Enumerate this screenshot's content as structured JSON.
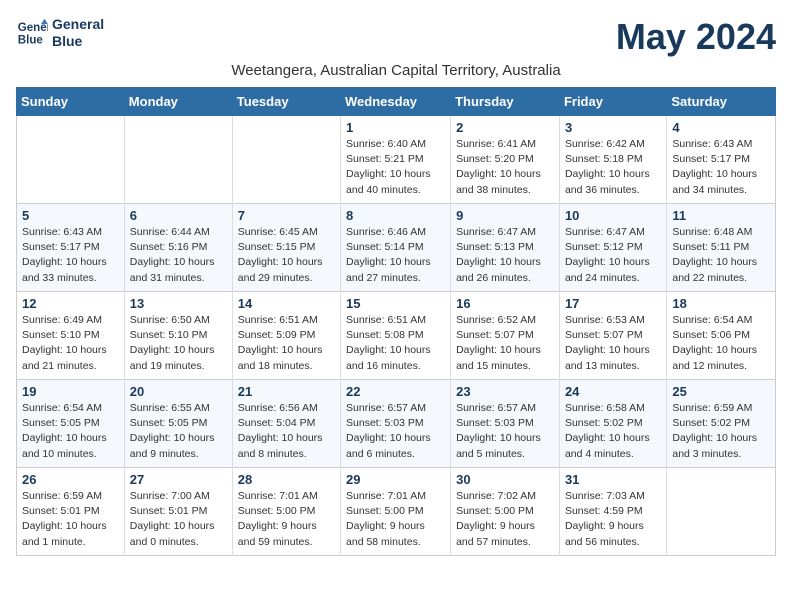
{
  "logo": {
    "text_line1": "General",
    "text_line2": "Blue"
  },
  "title": "May 2024",
  "subtitle": "Weetangera, Australian Capital Territory, Australia",
  "header_days": [
    "Sunday",
    "Monday",
    "Tuesday",
    "Wednesday",
    "Thursday",
    "Friday",
    "Saturday"
  ],
  "weeks": [
    [
      {
        "day": "",
        "info": ""
      },
      {
        "day": "",
        "info": ""
      },
      {
        "day": "",
        "info": ""
      },
      {
        "day": "1",
        "info": "Sunrise: 6:40 AM\nSunset: 5:21 PM\nDaylight: 10 hours\nand 40 minutes."
      },
      {
        "day": "2",
        "info": "Sunrise: 6:41 AM\nSunset: 5:20 PM\nDaylight: 10 hours\nand 38 minutes."
      },
      {
        "day": "3",
        "info": "Sunrise: 6:42 AM\nSunset: 5:18 PM\nDaylight: 10 hours\nand 36 minutes."
      },
      {
        "day": "4",
        "info": "Sunrise: 6:43 AM\nSunset: 5:17 PM\nDaylight: 10 hours\nand 34 minutes."
      }
    ],
    [
      {
        "day": "5",
        "info": "Sunrise: 6:43 AM\nSunset: 5:17 PM\nDaylight: 10 hours\nand 33 minutes."
      },
      {
        "day": "6",
        "info": "Sunrise: 6:44 AM\nSunset: 5:16 PM\nDaylight: 10 hours\nand 31 minutes."
      },
      {
        "day": "7",
        "info": "Sunrise: 6:45 AM\nSunset: 5:15 PM\nDaylight: 10 hours\nand 29 minutes."
      },
      {
        "day": "8",
        "info": "Sunrise: 6:46 AM\nSunset: 5:14 PM\nDaylight: 10 hours\nand 27 minutes."
      },
      {
        "day": "9",
        "info": "Sunrise: 6:47 AM\nSunset: 5:13 PM\nDaylight: 10 hours\nand 26 minutes."
      },
      {
        "day": "10",
        "info": "Sunrise: 6:47 AM\nSunset: 5:12 PM\nDaylight: 10 hours\nand 24 minutes."
      },
      {
        "day": "11",
        "info": "Sunrise: 6:48 AM\nSunset: 5:11 PM\nDaylight: 10 hours\nand 22 minutes."
      }
    ],
    [
      {
        "day": "12",
        "info": "Sunrise: 6:49 AM\nSunset: 5:10 PM\nDaylight: 10 hours\nand 21 minutes."
      },
      {
        "day": "13",
        "info": "Sunrise: 6:50 AM\nSunset: 5:10 PM\nDaylight: 10 hours\nand 19 minutes."
      },
      {
        "day": "14",
        "info": "Sunrise: 6:51 AM\nSunset: 5:09 PM\nDaylight: 10 hours\nand 18 minutes."
      },
      {
        "day": "15",
        "info": "Sunrise: 6:51 AM\nSunset: 5:08 PM\nDaylight: 10 hours\nand 16 minutes."
      },
      {
        "day": "16",
        "info": "Sunrise: 6:52 AM\nSunset: 5:07 PM\nDaylight: 10 hours\nand 15 minutes."
      },
      {
        "day": "17",
        "info": "Sunrise: 6:53 AM\nSunset: 5:07 PM\nDaylight: 10 hours\nand 13 minutes."
      },
      {
        "day": "18",
        "info": "Sunrise: 6:54 AM\nSunset: 5:06 PM\nDaylight: 10 hours\nand 12 minutes."
      }
    ],
    [
      {
        "day": "19",
        "info": "Sunrise: 6:54 AM\nSunset: 5:05 PM\nDaylight: 10 hours\nand 10 minutes."
      },
      {
        "day": "20",
        "info": "Sunrise: 6:55 AM\nSunset: 5:05 PM\nDaylight: 10 hours\nand 9 minutes."
      },
      {
        "day": "21",
        "info": "Sunrise: 6:56 AM\nSunset: 5:04 PM\nDaylight: 10 hours\nand 8 minutes."
      },
      {
        "day": "22",
        "info": "Sunrise: 6:57 AM\nSunset: 5:03 PM\nDaylight: 10 hours\nand 6 minutes."
      },
      {
        "day": "23",
        "info": "Sunrise: 6:57 AM\nSunset: 5:03 PM\nDaylight: 10 hours\nand 5 minutes."
      },
      {
        "day": "24",
        "info": "Sunrise: 6:58 AM\nSunset: 5:02 PM\nDaylight: 10 hours\nand 4 minutes."
      },
      {
        "day": "25",
        "info": "Sunrise: 6:59 AM\nSunset: 5:02 PM\nDaylight: 10 hours\nand 3 minutes."
      }
    ],
    [
      {
        "day": "26",
        "info": "Sunrise: 6:59 AM\nSunset: 5:01 PM\nDaylight: 10 hours\nand 1 minute."
      },
      {
        "day": "27",
        "info": "Sunrise: 7:00 AM\nSunset: 5:01 PM\nDaylight: 10 hours\nand 0 minutes."
      },
      {
        "day": "28",
        "info": "Sunrise: 7:01 AM\nSunset: 5:00 PM\nDaylight: 9 hours\nand 59 minutes."
      },
      {
        "day": "29",
        "info": "Sunrise: 7:01 AM\nSunset: 5:00 PM\nDaylight: 9 hours\nand 58 minutes."
      },
      {
        "day": "30",
        "info": "Sunrise: 7:02 AM\nSunset: 5:00 PM\nDaylight: 9 hours\nand 57 minutes."
      },
      {
        "day": "31",
        "info": "Sunrise: 7:03 AM\nSunset: 4:59 PM\nDaylight: 9 hours\nand 56 minutes."
      },
      {
        "day": "",
        "info": ""
      }
    ]
  ]
}
